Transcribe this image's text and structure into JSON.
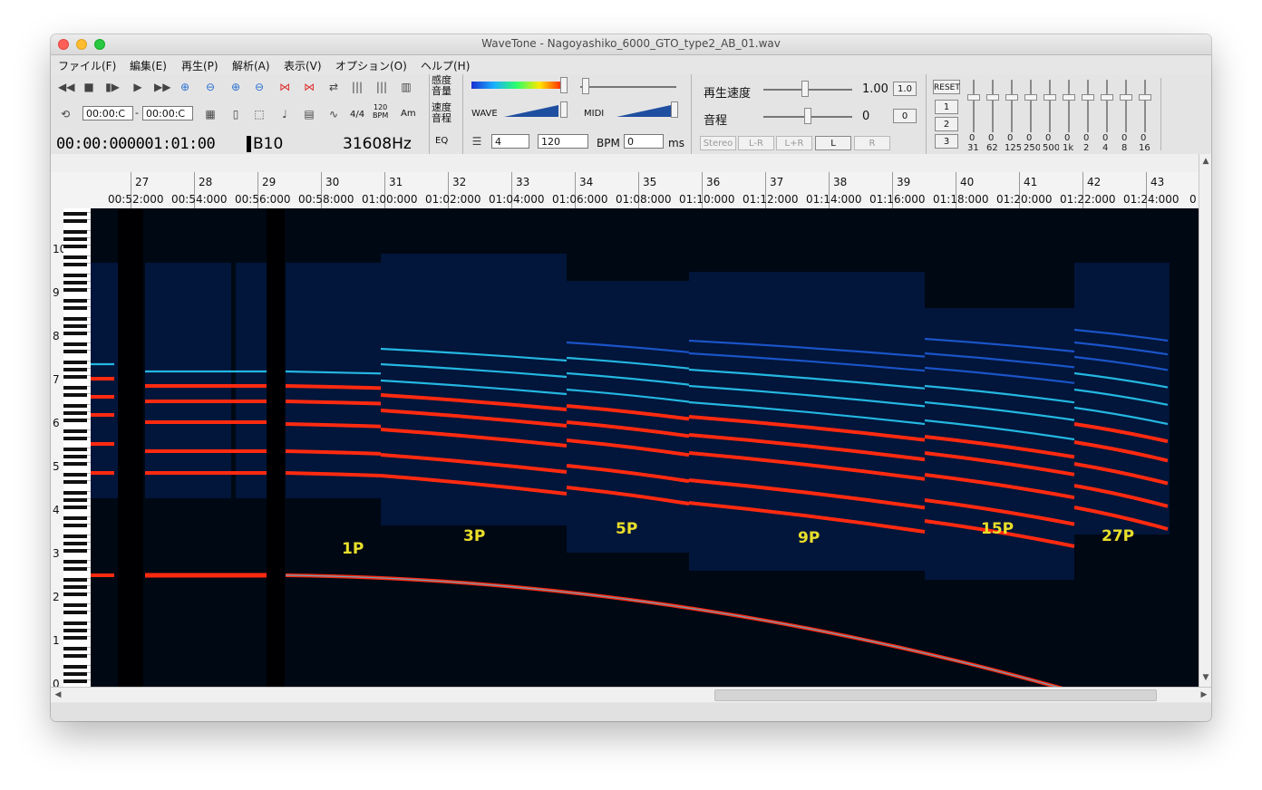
{
  "window": {
    "title": "WaveTone - Nagoyashiko_6000_GTO_type2_AB_01.wav"
  },
  "menu": [
    {
      "label": "ファイル(F)"
    },
    {
      "label": "編集(E)"
    },
    {
      "label": "再生(P)"
    },
    {
      "label": "解析(A)"
    },
    {
      "label": "表示(V)"
    },
    {
      "label": "オプション(O)"
    },
    {
      "label": "ヘルプ(H)"
    }
  ],
  "toolbar": {
    "loop_start": "00:00:C",
    "loop_sep": "-",
    "loop_end": "00:00:C",
    "time_sig": "4/4",
    "bpm_icon_top": "120",
    "bpm_icon_bottom": "BPM",
    "chord_icon": "Am"
  },
  "status": {
    "time": "00:00:000001:01:00",
    "note": "B10",
    "frequency": "31608Hz"
  },
  "panel": {
    "sensitivity_label_1": "感度",
    "sensitivity_label_2": "音量",
    "speed_label_1": "速度",
    "speed_label_2": "音程",
    "eq_label": "EQ",
    "wave_label": "WAVE",
    "midi_label": "MIDI",
    "beats_value": "4",
    "bpm_value": "120",
    "bpm_label": "BPM",
    "ms_value": "0",
    "ms_label": "ms"
  },
  "playback": {
    "speed_label": "再生速度",
    "speed_value": "1.00",
    "speed_reset": "1.0",
    "pitch_label": "音程",
    "pitch_value": "0",
    "pitch_reset": "0",
    "stereo": "Stereo",
    "lminusr": "L-R",
    "lplusr": "L+R",
    "left": "L",
    "right": "R"
  },
  "eq": {
    "reset": "RESET",
    "preset1": "1",
    "preset2": "2",
    "preset3": "3",
    "bands": [
      {
        "freq": "31",
        "value": "0"
      },
      {
        "freq": "62",
        "value": "0"
      },
      {
        "freq": "125",
        "value": "0"
      },
      {
        "freq": "250",
        "value": "0"
      },
      {
        "freq": "500",
        "value": "0"
      },
      {
        "freq": "1k",
        "value": "0"
      },
      {
        "freq": "2",
        "value": "0"
      },
      {
        "freq": "4",
        "value": "0"
      },
      {
        "freq": "8",
        "value": "0"
      },
      {
        "freq": "16",
        "value": "0"
      }
    ]
  },
  "ruler": {
    "measures": [
      "27",
      "28",
      "29",
      "30",
      "31",
      "32",
      "33",
      "34",
      "35",
      "36",
      "37",
      "38",
      "39",
      "40",
      "41",
      "42",
      "43"
    ],
    "times": [
      "00:52:000",
      "00:54:000",
      "00:56:000",
      "00:58:000",
      "01:00:000",
      "01:02:000",
      "01:04:000",
      "01:06:000",
      "01:08:000",
      "01:10:000",
      "01:12:000",
      "01:14:000",
      "01:16:000",
      "01:18:000",
      "01:20:000",
      "01:22:000",
      "01:24:000"
    ],
    "trailing_time": "0"
  },
  "octaves": [
    "10",
    "9",
    "8",
    "7",
    "6",
    "5",
    "4",
    "3",
    "2",
    "1",
    "0"
  ],
  "annotations": [
    "1P",
    "3P",
    "5P",
    "9P",
    "15P",
    "27P"
  ],
  "colors": {
    "spec_bg": "#000814",
    "harmonic_red": "#ff2a10",
    "harmonic_cyan": "#2ad4ff",
    "harmonic_blue": "#1f5fe0",
    "label_yellow": "#e9df2a"
  }
}
